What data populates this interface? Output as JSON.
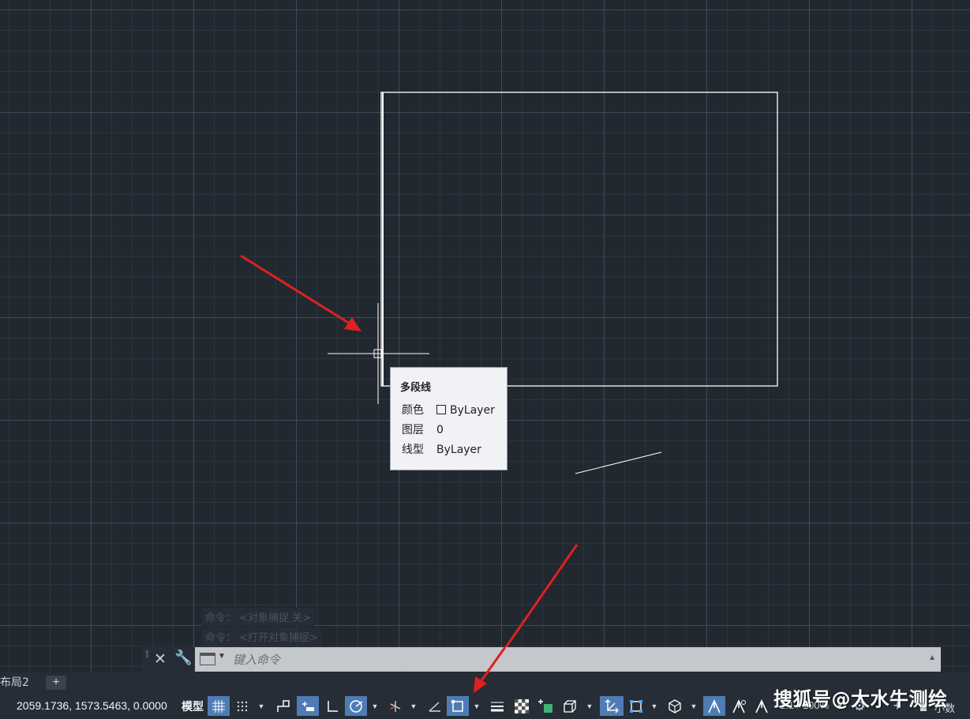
{
  "tooltip": {
    "title": "多段线",
    "rows": [
      {
        "key": "颜色",
        "value": "ByLayer",
        "swatch": true
      },
      {
        "key": "图层",
        "value": "0"
      },
      {
        "key": "线型",
        "value": "ByLayer"
      }
    ]
  },
  "command_history": [
    "命令： <对象捕捉 关>",
    "命令： <打开对象捕捉>"
  ],
  "command_line": {
    "placeholder": "键入命令"
  },
  "layout_tabs": {
    "active": "布局2",
    "add_label": "+"
  },
  "status_bar": {
    "coordinates": "2059.1736, 1573.5463, 0.0000",
    "model_label": "模型",
    "zoom": "1:1 / 100%",
    "units_label": "小数",
    "grid_on": true,
    "polar_on": true,
    "ortho_on": true,
    "selection_cycling_on": true,
    "dynamic_ucs_on": true,
    "annotation_visible_on": true
  },
  "watermark": "搜狐号@大水牛测绘",
  "colors": {
    "canvas_bg": "#212830",
    "toolbar_bg": "#262d36",
    "active_toggle": "#4f7cb4",
    "annotation_arrow": "#e02020",
    "geometry": "#ffffff"
  }
}
